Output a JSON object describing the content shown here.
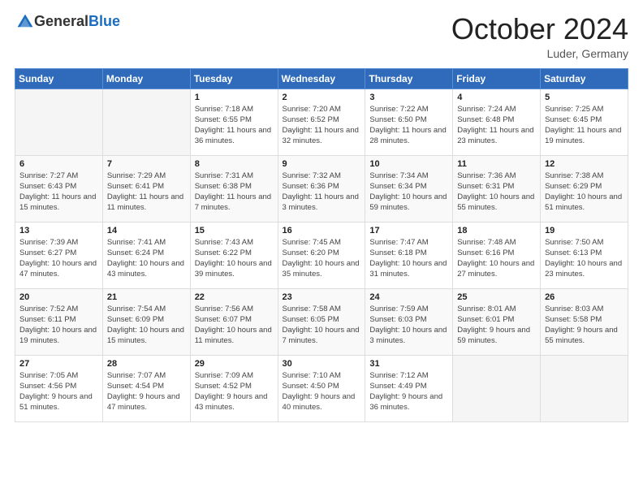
{
  "header": {
    "logo_general": "General",
    "logo_blue": "Blue",
    "month_title": "October 2024",
    "subtitle": "Luder, Germany"
  },
  "weekdays": [
    "Sunday",
    "Monday",
    "Tuesday",
    "Wednesday",
    "Thursday",
    "Friday",
    "Saturday"
  ],
  "weeks": [
    [
      {
        "day": "",
        "sunrise": "",
        "sunset": "",
        "daylight": ""
      },
      {
        "day": "",
        "sunrise": "",
        "sunset": "",
        "daylight": ""
      },
      {
        "day": "1",
        "sunrise": "Sunrise: 7:18 AM",
        "sunset": "Sunset: 6:55 PM",
        "daylight": "Daylight: 11 hours and 36 minutes."
      },
      {
        "day": "2",
        "sunrise": "Sunrise: 7:20 AM",
        "sunset": "Sunset: 6:52 PM",
        "daylight": "Daylight: 11 hours and 32 minutes."
      },
      {
        "day": "3",
        "sunrise": "Sunrise: 7:22 AM",
        "sunset": "Sunset: 6:50 PM",
        "daylight": "Daylight: 11 hours and 28 minutes."
      },
      {
        "day": "4",
        "sunrise": "Sunrise: 7:24 AM",
        "sunset": "Sunset: 6:48 PM",
        "daylight": "Daylight: 11 hours and 23 minutes."
      },
      {
        "day": "5",
        "sunrise": "Sunrise: 7:25 AM",
        "sunset": "Sunset: 6:45 PM",
        "daylight": "Daylight: 11 hours and 19 minutes."
      }
    ],
    [
      {
        "day": "6",
        "sunrise": "Sunrise: 7:27 AM",
        "sunset": "Sunset: 6:43 PM",
        "daylight": "Daylight: 11 hours and 15 minutes."
      },
      {
        "day": "7",
        "sunrise": "Sunrise: 7:29 AM",
        "sunset": "Sunset: 6:41 PM",
        "daylight": "Daylight: 11 hours and 11 minutes."
      },
      {
        "day": "8",
        "sunrise": "Sunrise: 7:31 AM",
        "sunset": "Sunset: 6:38 PM",
        "daylight": "Daylight: 11 hours and 7 minutes."
      },
      {
        "day": "9",
        "sunrise": "Sunrise: 7:32 AM",
        "sunset": "Sunset: 6:36 PM",
        "daylight": "Daylight: 11 hours and 3 minutes."
      },
      {
        "day": "10",
        "sunrise": "Sunrise: 7:34 AM",
        "sunset": "Sunset: 6:34 PM",
        "daylight": "Daylight: 10 hours and 59 minutes."
      },
      {
        "day": "11",
        "sunrise": "Sunrise: 7:36 AM",
        "sunset": "Sunset: 6:31 PM",
        "daylight": "Daylight: 10 hours and 55 minutes."
      },
      {
        "day": "12",
        "sunrise": "Sunrise: 7:38 AM",
        "sunset": "Sunset: 6:29 PM",
        "daylight": "Daylight: 10 hours and 51 minutes."
      }
    ],
    [
      {
        "day": "13",
        "sunrise": "Sunrise: 7:39 AM",
        "sunset": "Sunset: 6:27 PM",
        "daylight": "Daylight: 10 hours and 47 minutes."
      },
      {
        "day": "14",
        "sunrise": "Sunrise: 7:41 AM",
        "sunset": "Sunset: 6:24 PM",
        "daylight": "Daylight: 10 hours and 43 minutes."
      },
      {
        "day": "15",
        "sunrise": "Sunrise: 7:43 AM",
        "sunset": "Sunset: 6:22 PM",
        "daylight": "Daylight: 10 hours and 39 minutes."
      },
      {
        "day": "16",
        "sunrise": "Sunrise: 7:45 AM",
        "sunset": "Sunset: 6:20 PM",
        "daylight": "Daylight: 10 hours and 35 minutes."
      },
      {
        "day": "17",
        "sunrise": "Sunrise: 7:47 AM",
        "sunset": "Sunset: 6:18 PM",
        "daylight": "Daylight: 10 hours and 31 minutes."
      },
      {
        "day": "18",
        "sunrise": "Sunrise: 7:48 AM",
        "sunset": "Sunset: 6:16 PM",
        "daylight": "Daylight: 10 hours and 27 minutes."
      },
      {
        "day": "19",
        "sunrise": "Sunrise: 7:50 AM",
        "sunset": "Sunset: 6:13 PM",
        "daylight": "Daylight: 10 hours and 23 minutes."
      }
    ],
    [
      {
        "day": "20",
        "sunrise": "Sunrise: 7:52 AM",
        "sunset": "Sunset: 6:11 PM",
        "daylight": "Daylight: 10 hours and 19 minutes."
      },
      {
        "day": "21",
        "sunrise": "Sunrise: 7:54 AM",
        "sunset": "Sunset: 6:09 PM",
        "daylight": "Daylight: 10 hours and 15 minutes."
      },
      {
        "day": "22",
        "sunrise": "Sunrise: 7:56 AM",
        "sunset": "Sunset: 6:07 PM",
        "daylight": "Daylight: 10 hours and 11 minutes."
      },
      {
        "day": "23",
        "sunrise": "Sunrise: 7:58 AM",
        "sunset": "Sunset: 6:05 PM",
        "daylight": "Daylight: 10 hours and 7 minutes."
      },
      {
        "day": "24",
        "sunrise": "Sunrise: 7:59 AM",
        "sunset": "Sunset: 6:03 PM",
        "daylight": "Daylight: 10 hours and 3 minutes."
      },
      {
        "day": "25",
        "sunrise": "Sunrise: 8:01 AM",
        "sunset": "Sunset: 6:01 PM",
        "daylight": "Daylight: 9 hours and 59 minutes."
      },
      {
        "day": "26",
        "sunrise": "Sunrise: 8:03 AM",
        "sunset": "Sunset: 5:58 PM",
        "daylight": "Daylight: 9 hours and 55 minutes."
      }
    ],
    [
      {
        "day": "27",
        "sunrise": "Sunrise: 7:05 AM",
        "sunset": "Sunset: 4:56 PM",
        "daylight": "Daylight: 9 hours and 51 minutes."
      },
      {
        "day": "28",
        "sunrise": "Sunrise: 7:07 AM",
        "sunset": "Sunset: 4:54 PM",
        "daylight": "Daylight: 9 hours and 47 minutes."
      },
      {
        "day": "29",
        "sunrise": "Sunrise: 7:09 AM",
        "sunset": "Sunset: 4:52 PM",
        "daylight": "Daylight: 9 hours and 43 minutes."
      },
      {
        "day": "30",
        "sunrise": "Sunrise: 7:10 AM",
        "sunset": "Sunset: 4:50 PM",
        "daylight": "Daylight: 9 hours and 40 minutes."
      },
      {
        "day": "31",
        "sunrise": "Sunrise: 7:12 AM",
        "sunset": "Sunset: 4:49 PM",
        "daylight": "Daylight: 9 hours and 36 minutes."
      },
      {
        "day": "",
        "sunrise": "",
        "sunset": "",
        "daylight": ""
      },
      {
        "day": "",
        "sunrise": "",
        "sunset": "",
        "daylight": ""
      }
    ]
  ]
}
